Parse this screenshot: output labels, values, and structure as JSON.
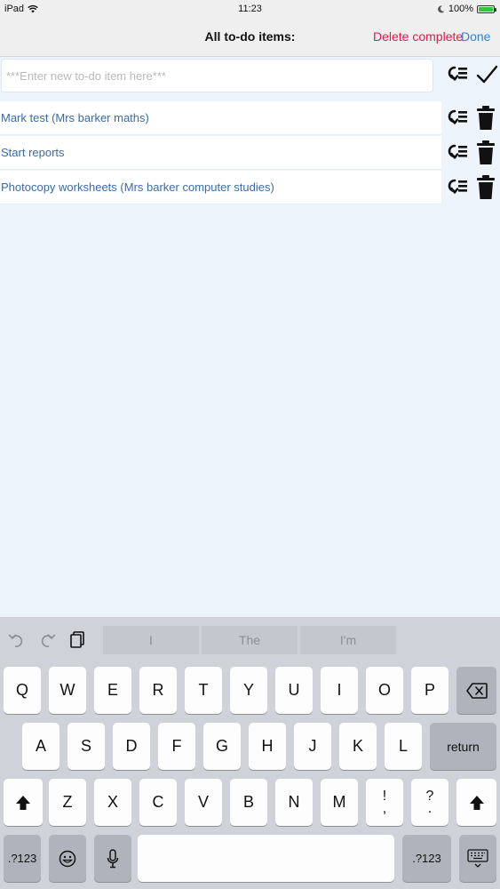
{
  "status_bar": {
    "device": "iPad",
    "time": "11:23",
    "battery": "100%"
  },
  "nav_bar": {
    "title": "All to-do items:",
    "delete_label": "Delete complete",
    "done_label": "Done"
  },
  "new_item": {
    "placeholder": "***Enter new to-do item here***",
    "value": ""
  },
  "todo_items": [
    {
      "label": "Mark test (Mrs barker maths)"
    },
    {
      "label": "Start reports"
    },
    {
      "label": "Photocopy worksheets (Mrs barker computer studies)"
    }
  ],
  "keyboard": {
    "suggestions": [
      "I",
      "The",
      "I'm"
    ],
    "row1": [
      "Q",
      "W",
      "E",
      "R",
      "T",
      "Y",
      "U",
      "I",
      "O",
      "P"
    ],
    "row2": [
      "A",
      "S",
      "D",
      "F",
      "G",
      "H",
      "J",
      "K",
      "L"
    ],
    "row3": [
      "Z",
      "X",
      "C",
      "V",
      "B",
      "N",
      "M"
    ],
    "row3_punct": [
      {
        "top": "!",
        "bottom": ","
      },
      {
        "top": "?",
        "bottom": "."
      }
    ],
    "return_label": "return",
    "numbers_label": ".?123"
  },
  "colors": {
    "accent": "#2f82d6",
    "destructive": "#e8174d",
    "item_text": "#3a6ba8",
    "background": "#edf4fc"
  },
  "icons": {
    "reorder": "reorder-icon",
    "confirm": "checkmark-icon",
    "delete": "trash-icon",
    "undo": "undo-icon",
    "redo": "redo-icon",
    "paste": "paste-icon"
  }
}
